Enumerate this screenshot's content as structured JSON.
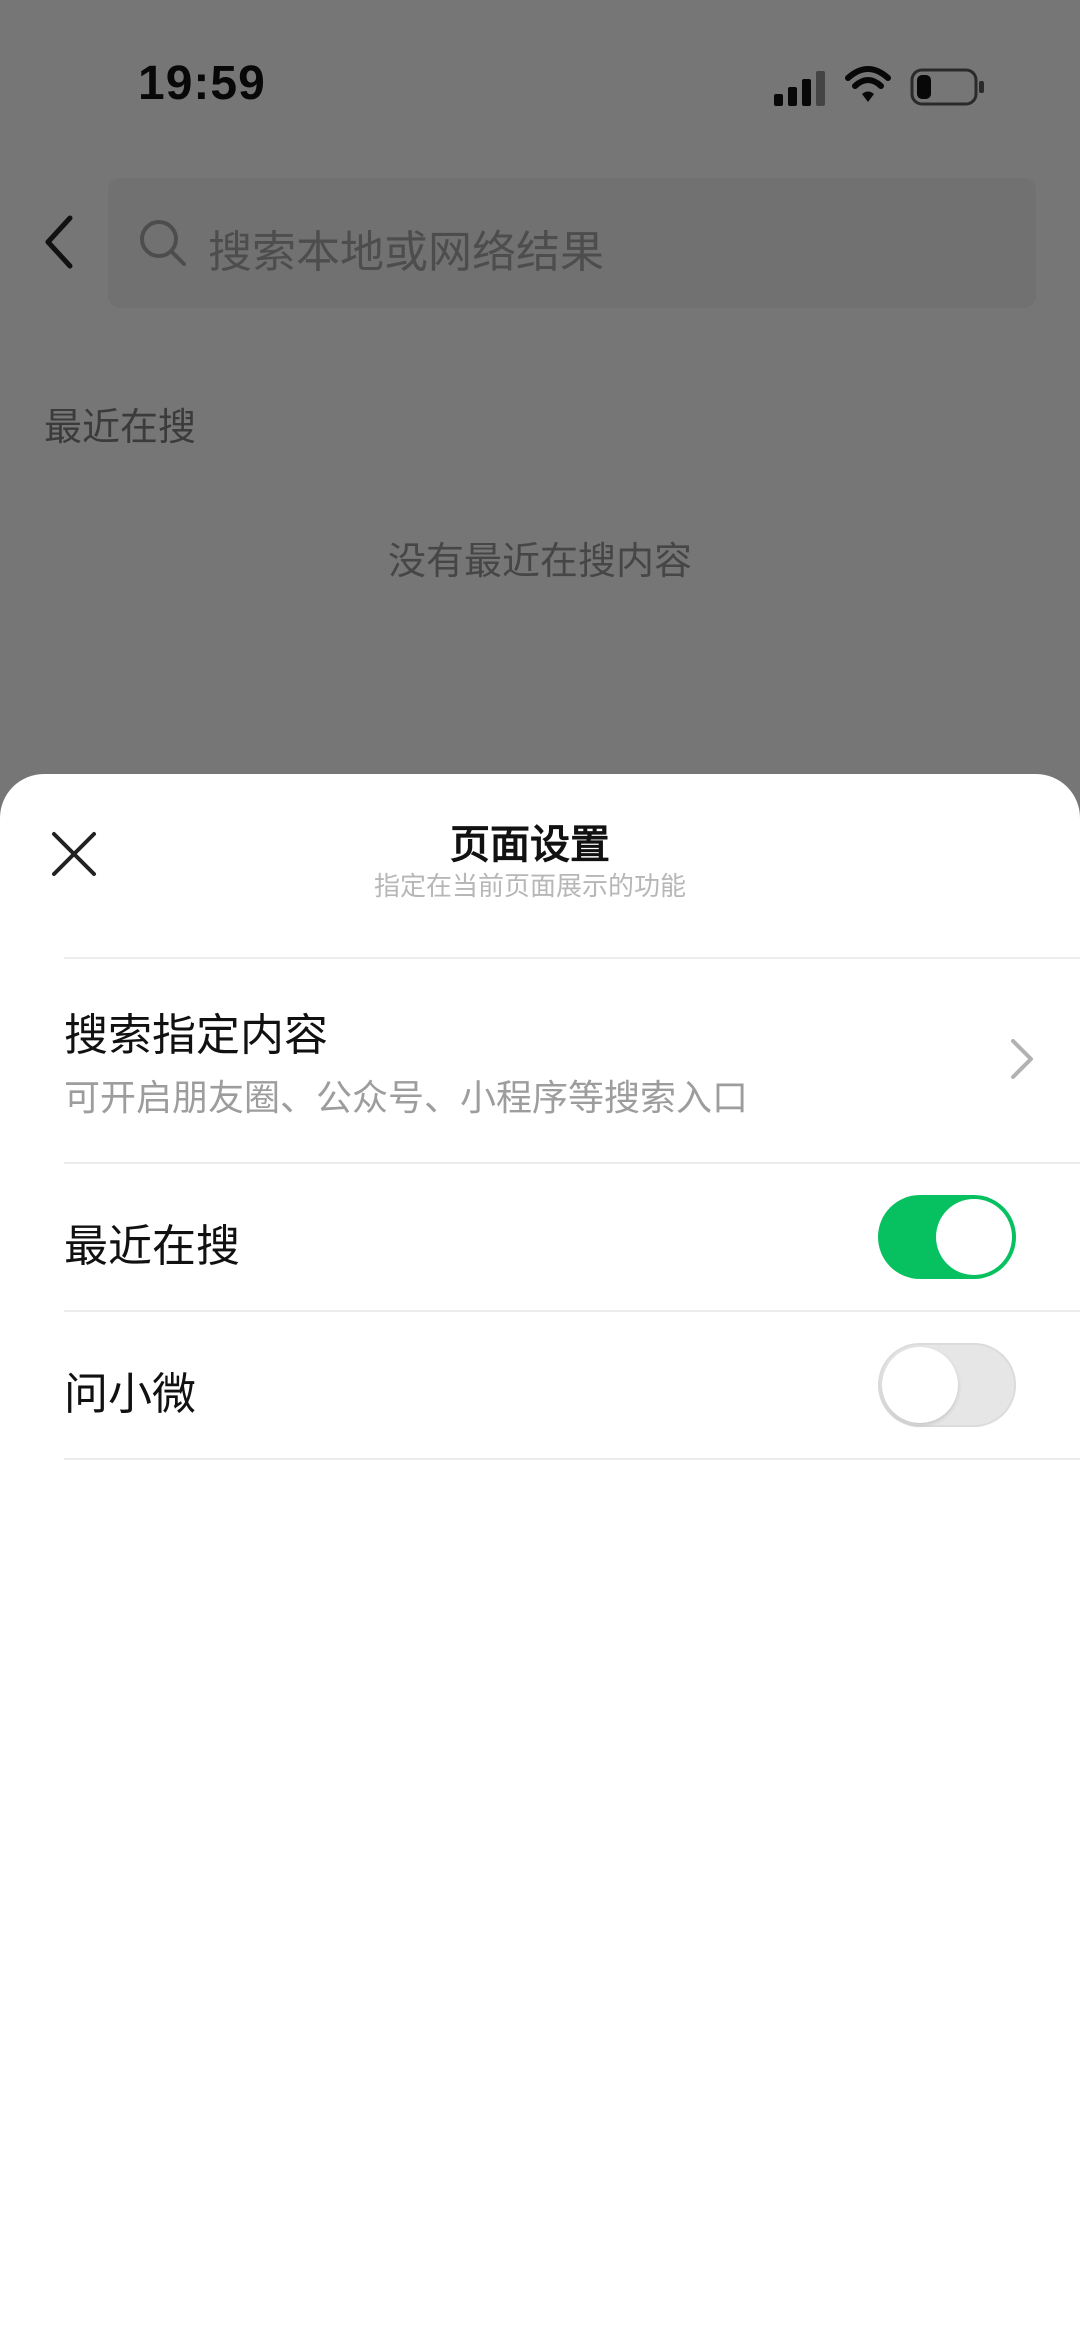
{
  "status_bar": {
    "time": "19:59"
  },
  "search": {
    "placeholder": "搜索本地或网络结果"
  },
  "recent": {
    "label": "最近在搜",
    "empty_text": "没有最近在搜内容"
  },
  "sheet": {
    "title": "页面设置",
    "subtitle": "指定在当前页面展示的功能",
    "items": [
      {
        "title": "搜索指定内容",
        "description": "可开启朋友圈、公众号、小程序等搜索入口"
      },
      {
        "title": "最近在搜",
        "enabled": true
      },
      {
        "title": "问小微",
        "enabled": false
      }
    ]
  },
  "colors": {
    "accent": "#07c160",
    "overlay": "rgba(0,0,0,0.5)"
  },
  "icons": [
    "signal-icon",
    "wifi-icon",
    "battery-icon",
    "back-icon",
    "search-icon",
    "close-icon",
    "chevron-right-icon"
  ]
}
